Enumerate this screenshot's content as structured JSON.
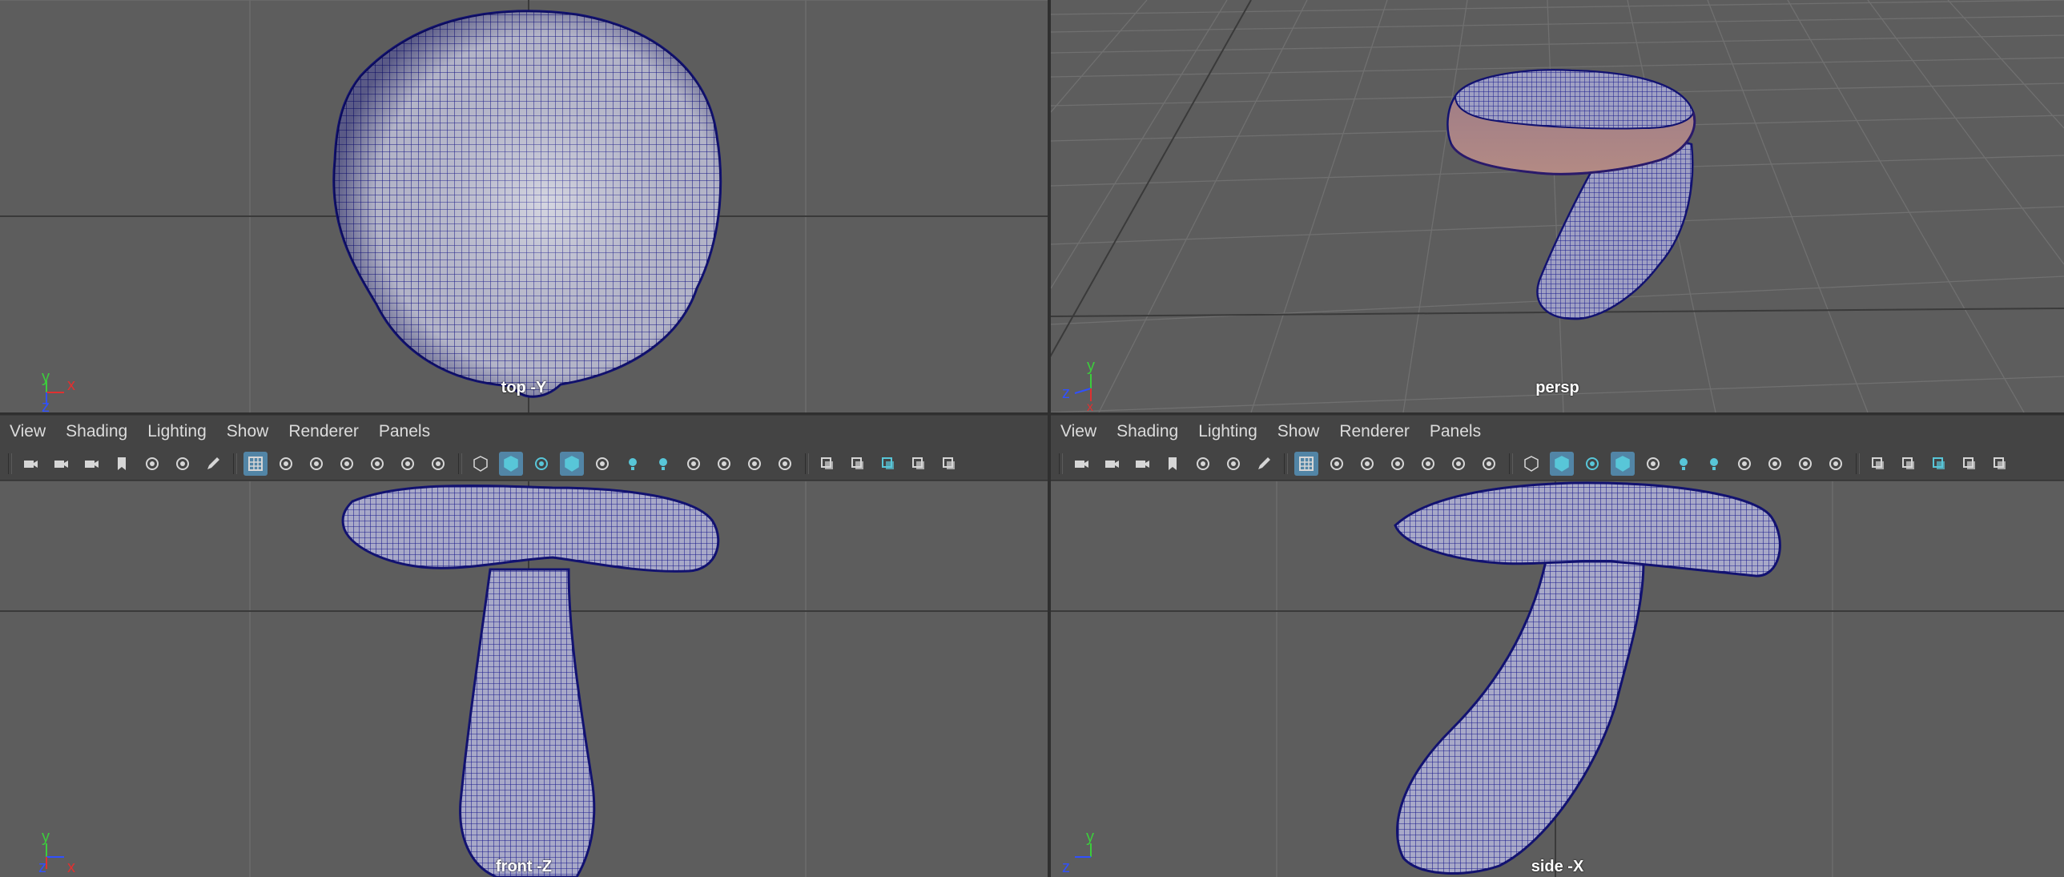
{
  "colors": {
    "viewport_bg": "#5d5d5d",
    "panel_bg": "#444444",
    "wire": "#1a1a8c",
    "axis_y": "#3ccc3c",
    "axis_x": "#e03030",
    "axis_z": "#3050ff",
    "active_tool": "#5285a6"
  },
  "viewports": {
    "top": {
      "label": "top -Y",
      "axis": [
        "y",
        "x",
        "z"
      ]
    },
    "persp": {
      "label": "persp",
      "axis": [
        "y",
        "z",
        "x"
      ]
    },
    "front": {
      "label": "front -Z",
      "axis": [
        "y",
        "z",
        "x"
      ]
    },
    "side": {
      "label": "side -X",
      "axis": [
        "y",
        "z"
      ]
    }
  },
  "panel_menu": [
    "View",
    "Shading",
    "Lighting",
    "Show",
    "Renderer",
    "Panels"
  ],
  "toolbar_icons": [
    "camera-icon",
    "lock-camera-icon",
    "camera-attributes-icon",
    "bookmark-icon",
    "image-plane-icon",
    "2d-pan-zoom-icon",
    "grease-pencil-icon",
    "grid-icon",
    "film-gate-icon",
    "resolution-gate-icon",
    "gate-mask-icon",
    "field-chart-icon",
    "safe-action-icon",
    "safe-title-icon",
    "wireframe-icon",
    "smooth-shade-icon",
    "use-default-material-icon",
    "wireframe-on-shaded-icon",
    "textured-icon",
    "use-all-lights-icon",
    "shadows-icon",
    "screen-space-ao-icon",
    "motion-blur-icon",
    "multisample-aa-icon",
    "depth-of-field-icon",
    "isolate-select-icon",
    "xray-icon",
    "xray-joints-icon",
    "xray-active-components-icon",
    "backface-culling-icon"
  ]
}
